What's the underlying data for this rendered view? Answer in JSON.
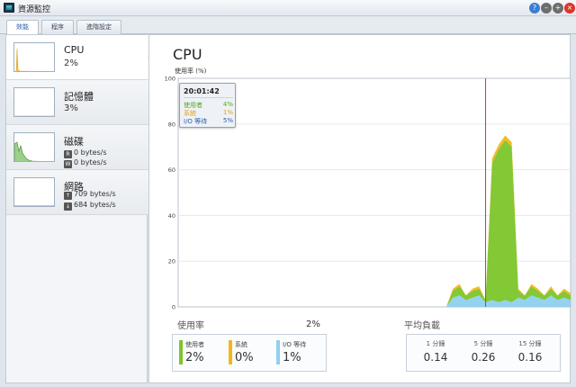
{
  "window": {
    "title": "資源監控"
  },
  "tabs": [
    {
      "label": "效能"
    },
    {
      "label": "程序"
    },
    {
      "label": "進階設定"
    }
  ],
  "sidebar": {
    "cpu": {
      "name": "CPU",
      "value": "2%"
    },
    "memory": {
      "name": "記憶體",
      "value": "3%"
    },
    "disk": {
      "name": "磁碟",
      "read_badge": "R",
      "read": "0 bytes/s",
      "write_badge": "W",
      "write": "0 bytes/s"
    },
    "network": {
      "name": "網路",
      "up": "709 bytes/s",
      "down": "684 bytes/s"
    }
  },
  "main": {
    "title": "CPU",
    "y_unit": "使用率 (%)",
    "tooltip": {
      "time": "20:01:42",
      "rows": [
        {
          "label": "使用者",
          "value": "4%",
          "color": "#5aa51e"
        },
        {
          "label": "系統",
          "value": "1%",
          "color": "#e0a21a"
        },
        {
          "label": "I/O 等待",
          "value": "5%",
          "color": "#2b5fa8"
        }
      ]
    },
    "usage": {
      "label": "使用率",
      "total": "2%",
      "items": [
        {
          "name": "使用者",
          "value": "2%",
          "color": "#7cc52a"
        },
        {
          "name": "系統",
          "value": "0%",
          "color": "#f2b718"
        },
        {
          "name": "I/O 等待",
          "value": "1%",
          "color": "#8fd0ee"
        }
      ]
    },
    "load": {
      "label": "平均負載",
      "items": [
        {
          "name": "1 分鐘",
          "value": "0.14"
        },
        {
          "name": "5 分鐘",
          "value": "0.26"
        },
        {
          "name": "15 分鐘",
          "value": "0.16"
        }
      ]
    }
  },
  "chart_data": {
    "type": "area",
    "ylabel": "使用率 (%)",
    "ylim": [
      0,
      100
    ],
    "yticks": [
      "0",
      "20",
      "40",
      "60",
      "80",
      "100"
    ],
    "x": [
      0,
      1,
      2,
      3,
      4,
      5,
      6,
      7,
      8,
      9,
      10,
      11,
      12,
      13,
      14,
      15,
      16,
      17,
      18,
      19,
      20,
      21,
      22,
      23,
      24,
      25,
      26,
      27,
      28,
      29,
      30,
      31,
      32,
      33,
      34,
      35,
      36,
      37,
      38,
      39,
      40,
      41,
      42,
      43,
      44,
      45,
      46,
      47,
      48,
      49,
      50,
      51,
      52,
      53,
      54,
      55,
      56,
      57,
      58,
      59,
      60
    ],
    "series": [
      {
        "name": "使用者",
        "color": "#7cc52a",
        "values": [
          0,
          0,
          0,
          0,
          0,
          0,
          0,
          0,
          0,
          0,
          0,
          0,
          0,
          0,
          0,
          0,
          0,
          0,
          0,
          0,
          0,
          0,
          0,
          0,
          0,
          0,
          0,
          0,
          0,
          0,
          0,
          0,
          0,
          0,
          0,
          0,
          0,
          0,
          0,
          0,
          0,
          0,
          3,
          4,
          2,
          3,
          3,
          1,
          60,
          67,
          70,
          68,
          3,
          2,
          4,
          3,
          2,
          3,
          2,
          3,
          2
        ]
      },
      {
        "name": "系統",
        "color": "#f2b718",
        "values": [
          0,
          0,
          0,
          0,
          0,
          0,
          0,
          0,
          0,
          0,
          0,
          0,
          0,
          0,
          0,
          0,
          0,
          0,
          0,
          0,
          0,
          0,
          0,
          0,
          0,
          0,
          0,
          0,
          0,
          0,
          0,
          0,
          0,
          0,
          0,
          0,
          0,
          0,
          0,
          0,
          0,
          0,
          1,
          1,
          0,
          1,
          1,
          0,
          2,
          2,
          2,
          2,
          1,
          0,
          1,
          1,
          0,
          1,
          0,
          1,
          1
        ]
      },
      {
        "name": "I/O 等待",
        "color": "#8fd0ee",
        "values": [
          0,
          0,
          0,
          0,
          0,
          0,
          0,
          0,
          0,
          0,
          0,
          0,
          0,
          0,
          0,
          0,
          0,
          0,
          0,
          0,
          0,
          0,
          0,
          0,
          0,
          0,
          0,
          0,
          0,
          0,
          0,
          0,
          0,
          0,
          0,
          0,
          0,
          0,
          0,
          0,
          0,
          0,
          4,
          5,
          3,
          4,
          5,
          2,
          3,
          2,
          3,
          2,
          4,
          3,
          5,
          4,
          3,
          5,
          3,
          4,
          3
        ]
      }
    ],
    "cursor_x": 47,
    "grid": true
  }
}
